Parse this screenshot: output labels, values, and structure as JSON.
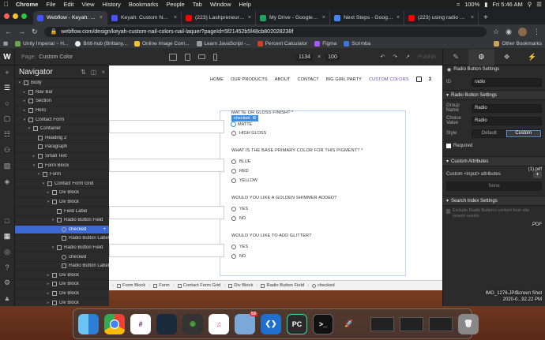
{
  "menubar": {
    "app": "Chrome",
    "items": [
      "File",
      "Edit",
      "View",
      "History",
      "Bookmarks",
      "People",
      "Tab",
      "Window",
      "Help"
    ],
    "battery": "100%",
    "clock": "Fri 5:46 AM"
  },
  "tabs": [
    {
      "title": "Webflow - Keyah: Custom Nail",
      "color": "#4353ff",
      "active": true
    },
    {
      "title": "Keyah: Custom Nail Colors",
      "color": "#4353ff"
    },
    {
      "title": "(223) Lashpreneur Ep. 1",
      "color": "#ff0000"
    },
    {
      "title": "My Drive - Google Drive",
      "color": "#1fa463"
    },
    {
      "title": "Next Steps - Google Docs",
      "color": "#4285f4"
    },
    {
      "title": "(223) using radio butt...",
      "color": "#ff0000"
    }
  ],
  "address": {
    "url": "webflow.com/design/keyah-custom-nail-colors-nail-laquer?pageId=5f21452b5f48cb802028238f"
  },
  "bookmarks": [
    "Unity Imperial ~ H...",
    "Britt-hub (Brittany...",
    "Online Image Com...",
    "Learn JavaScript -...",
    "Percent Calculator",
    "Figma",
    "Scrimba"
  ],
  "bookmarks_other": "Other Bookmarks",
  "webflow": {
    "page_label": "Page:",
    "page_name": "Custom Color",
    "width": "1134",
    "x": "×",
    "height": "100",
    "publish": "Publish"
  },
  "navigator": {
    "title": "Navigator",
    "items": [
      {
        "label": "Body",
        "depth": 0,
        "icon": "box",
        "arrow": "▾"
      },
      {
        "label": "Nav Bar",
        "depth": 1,
        "icon": "box",
        "arrow": "▸"
      },
      {
        "label": "Section",
        "depth": 1,
        "icon": "box",
        "arrow": "▸"
      },
      {
        "label": "Hero",
        "depth": 1,
        "icon": "box",
        "arrow": "▸"
      },
      {
        "label": "Contact Form",
        "depth": 1,
        "icon": "box",
        "arrow": "▾"
      },
      {
        "label": "Container",
        "depth": 2,
        "icon": "box",
        "arrow": "▾"
      },
      {
        "label": "Heading 2",
        "depth": 3,
        "icon": "box",
        "arrow": ""
      },
      {
        "label": "Paragraph",
        "depth": 3,
        "icon": "box",
        "arrow": ""
      },
      {
        "label": "Small Text",
        "depth": 3,
        "icon": "box",
        "arrow": "▸"
      },
      {
        "label": "Form Block",
        "depth": 3,
        "icon": "box",
        "arrow": "▾"
      },
      {
        "label": "Form",
        "depth": 4,
        "icon": "box",
        "arrow": "▾"
      },
      {
        "label": "Contact Form Grid",
        "depth": 5,
        "icon": "box",
        "arrow": "▾"
      },
      {
        "label": "Div Block",
        "depth": 6,
        "icon": "box",
        "arrow": "▸"
      },
      {
        "label": "Div Block",
        "depth": 6,
        "icon": "box",
        "arrow": "▾"
      },
      {
        "label": "Field Label",
        "depth": 7,
        "icon": "box",
        "arrow": ""
      },
      {
        "label": "Radio Button Field",
        "depth": 7,
        "icon": "box",
        "arrow": "▾"
      },
      {
        "label": "checked",
        "depth": 8,
        "icon": "rad",
        "arrow": "",
        "selected": true
      },
      {
        "label": "Radio Button Label",
        "depth": 8,
        "icon": "box",
        "arrow": ""
      },
      {
        "label": "Radio Button Field",
        "depth": 7,
        "icon": "box",
        "arrow": "▾"
      },
      {
        "label": "checked",
        "depth": 8,
        "icon": "rad",
        "arrow": ""
      },
      {
        "label": "Radio Button Label",
        "depth": 8,
        "icon": "box",
        "arrow": ""
      },
      {
        "label": "Div Block",
        "depth": 6,
        "icon": "box",
        "arrow": "▸"
      },
      {
        "label": "Div Block",
        "depth": 6,
        "icon": "box",
        "arrow": "▸"
      },
      {
        "label": "Div Block",
        "depth": 6,
        "icon": "box",
        "arrow": "▸"
      },
      {
        "label": "Div Block",
        "depth": 6,
        "icon": "box",
        "arrow": "▸"
      }
    ]
  },
  "site": {
    "nav": [
      "HOME",
      "OUR PRODUCTS",
      "ABOUT",
      "CONTACT",
      "BIG GIRL PARTY",
      "CUSTOM COLORS"
    ],
    "cart_count": "3",
    "q1": "MATTE OR GLOSS FINISH? *",
    "q1_opts": [
      "MATTE",
      "HIGH GLOSS"
    ],
    "selected_tag": "checked",
    "q2": "WHAT IS THE BASE PRIMARY COLOR FOR THIS PIGMENT? *",
    "q2_opts": [
      "BLUE",
      "RED",
      "YELLOW"
    ],
    "q3": "WOULD YOU LIKE A GOLDEN SHIMMER ADDED?",
    "q3_opts": [
      "YES",
      "NO"
    ],
    "q4": "WOULD YOU LIKE TO ADD GLITTER?",
    "q4_opts": [
      "YES",
      "NO"
    ]
  },
  "breadcrumbs": [
    "Form Block",
    "Form",
    "Contact Form Grid",
    "Div Block",
    "Radio Button Field",
    "checked"
  ],
  "panel": {
    "header": "Radio Button Settings",
    "id_label": "ID",
    "id_value": "radio",
    "section1": "Radio Button Settings",
    "group_label": "Group Name",
    "group_value": "Radio",
    "choice_label": "Choice Value",
    "choice_value": "Radio",
    "style_label": "Style",
    "style_default": "Default",
    "style_custom": "Custom",
    "required": "Required",
    "section2": "Custom Attributes",
    "attr_label": "Custom <input> attributes",
    "attr_none": "None",
    "section3": "Search Index Settings",
    "exclude_text": "Exclude Radio Button's content from site search results"
  },
  "desktop": {
    "file1": "IMG_1276.JPG",
    "file2": "Screen Shot",
    "file3": "2020-0...92.22 PM",
    "file4": "(1).pdf",
    "file5": ".PDF"
  },
  "dock": {
    "badge": "53"
  }
}
